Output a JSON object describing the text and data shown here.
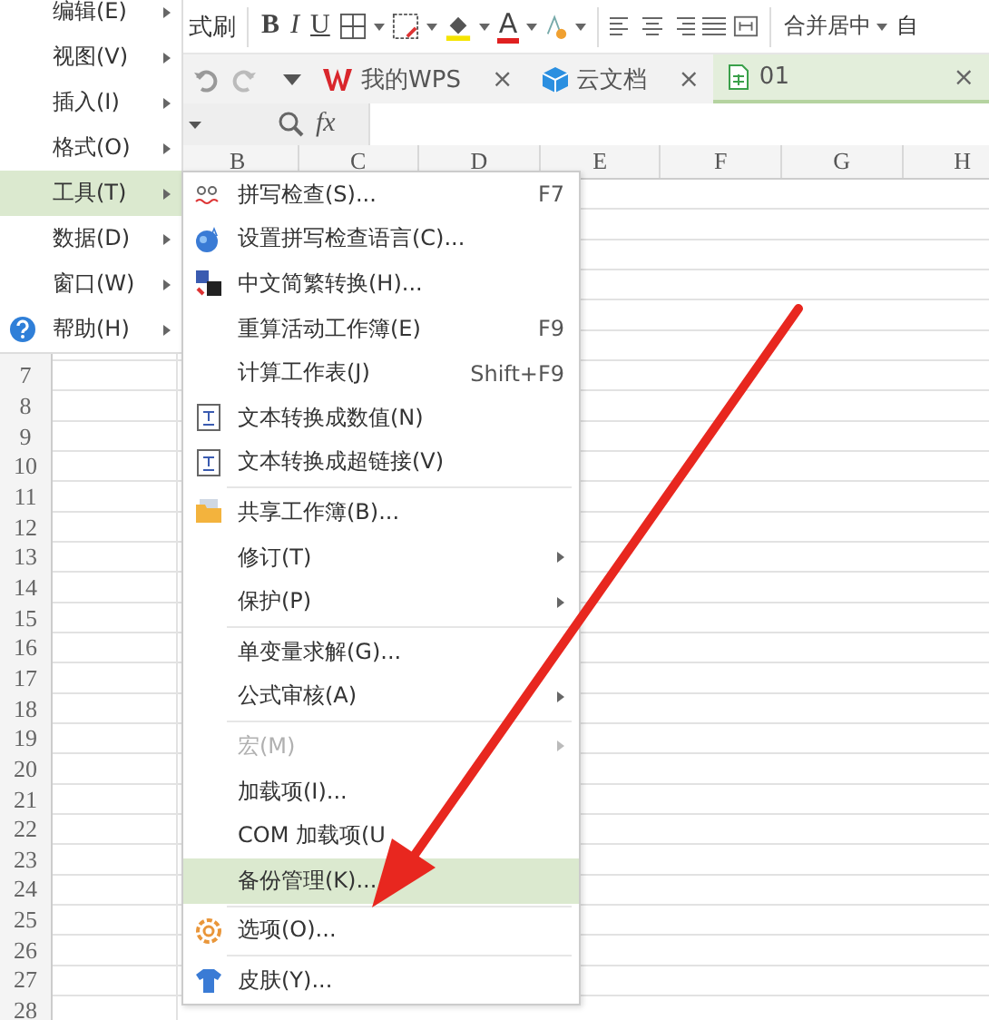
{
  "toolbar": {
    "format_painter": "式刷",
    "bold": "B",
    "italic": "I",
    "underline": "U",
    "font_color": "A",
    "merge": "合并居中",
    "cut_off": "自"
  },
  "tabs": [
    {
      "label": "我的WPS",
      "close": "×",
      "selected": false
    },
    {
      "label": "云文档",
      "close": "×",
      "selected": false
    },
    {
      "label": "01",
      "close": "×",
      "selected": true
    }
  ],
  "formula_bar": {
    "function_label": "fx"
  },
  "sheet": {
    "columns": [
      "B",
      "C",
      "D",
      "E",
      "F",
      "G",
      "H"
    ],
    "rows": [
      "7",
      "8",
      "9",
      "10",
      "11",
      "12",
      "13",
      "14",
      "15",
      "16",
      "17",
      "18",
      "19",
      "20",
      "21",
      "22",
      "23",
      "24",
      "25",
      "26",
      "27",
      "28"
    ]
  },
  "menu": {
    "items": [
      {
        "label": "编辑(E)",
        "selected": false
      },
      {
        "label": "视图(V)",
        "selected": false
      },
      {
        "label": "插入(I)",
        "selected": false
      },
      {
        "label": "格式(O)",
        "selected": false
      },
      {
        "label": "工具(T)",
        "selected": true
      },
      {
        "label": "数据(D)",
        "selected": false
      },
      {
        "label": "窗口(W)",
        "selected": false
      },
      {
        "label": "帮助(H)",
        "selected": false
      }
    ]
  },
  "submenu": {
    "items": [
      {
        "kind": "item",
        "label": "拼写检查(S)...",
        "shortcut": "F7",
        "submenu": false,
        "disabled": false,
        "selected": false
      },
      {
        "kind": "item",
        "label": "设置拼写检查语言(C)...",
        "submenu": false,
        "disabled": false,
        "selected": false
      },
      {
        "kind": "item",
        "label": "中文简繁转换(H)...",
        "submenu": false,
        "disabled": false,
        "selected": false
      },
      {
        "kind": "item",
        "label": "重算活动工作簿(E)",
        "shortcut": "F9",
        "submenu": false,
        "disabled": false,
        "selected": false
      },
      {
        "kind": "item",
        "label": "计算工作表(J)",
        "shortcut": "Shift+F9",
        "submenu": false,
        "disabled": false,
        "selected": false
      },
      {
        "kind": "item",
        "label": "文本转换成数值(N)",
        "submenu": false,
        "disabled": false,
        "selected": false
      },
      {
        "kind": "item",
        "label": "文本转换成超链接(V)",
        "submenu": false,
        "disabled": false,
        "selected": false
      },
      {
        "kind": "separator"
      },
      {
        "kind": "item",
        "label": "共享工作簿(B)...",
        "submenu": false,
        "disabled": false,
        "selected": false
      },
      {
        "kind": "item",
        "label": "修订(T)",
        "submenu": true,
        "disabled": false,
        "selected": false
      },
      {
        "kind": "item",
        "label": "保护(P)",
        "submenu": true,
        "disabled": false,
        "selected": false
      },
      {
        "kind": "separator"
      },
      {
        "kind": "item",
        "label": "单变量求解(G)...",
        "submenu": false,
        "disabled": false,
        "selected": false
      },
      {
        "kind": "item",
        "label": "公式审核(A)",
        "submenu": true,
        "disabled": false,
        "selected": false
      },
      {
        "kind": "separator"
      },
      {
        "kind": "item",
        "label": "宏(M)",
        "submenu": true,
        "disabled": true,
        "selected": false
      },
      {
        "kind": "item",
        "label": "加载项(I)...",
        "submenu": false,
        "disabled": false,
        "selected": false
      },
      {
        "kind": "item",
        "label": "COM 加载项(U",
        "submenu": false,
        "disabled": false,
        "selected": false
      },
      {
        "kind": "item",
        "label": "备份管理(K)...",
        "submenu": false,
        "disabled": false,
        "selected": true
      },
      {
        "kind": "separator"
      },
      {
        "kind": "item",
        "label": "选项(O)...",
        "submenu": false,
        "disabled": false,
        "selected": false
      },
      {
        "kind": "separator"
      },
      {
        "kind": "item",
        "label": "皮肤(Y)...",
        "submenu": false,
        "disabled": false,
        "selected": false
      }
    ]
  }
}
